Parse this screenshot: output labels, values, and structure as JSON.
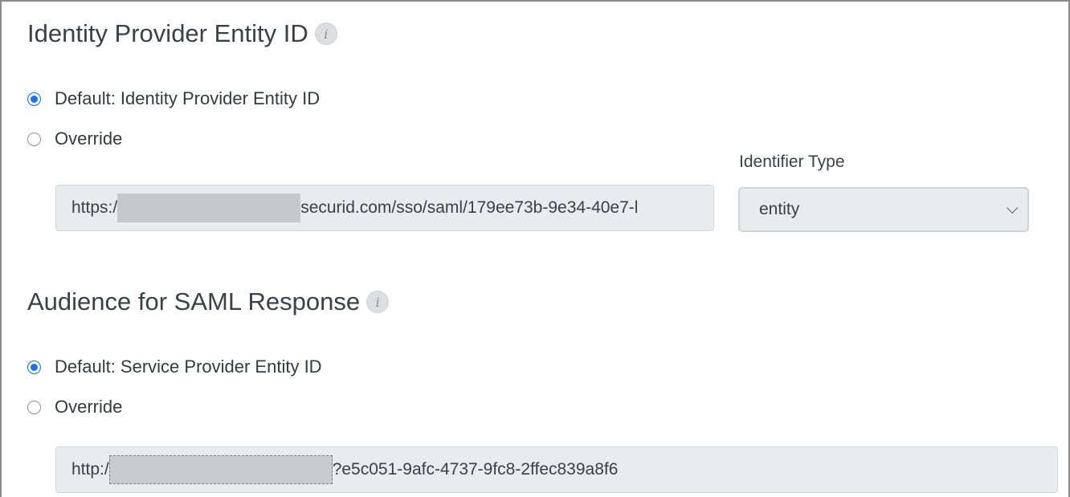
{
  "idp_section": {
    "title": "Identity Provider Entity ID",
    "info_icon": "info-icon",
    "radio_default_label": "Default: Identity Provider Entity ID",
    "radio_default_checked": true,
    "radio_override_label": "Override",
    "radio_override_checked": false,
    "entity_url_prefix": "https:/",
    "entity_url_suffix": "securid.com/sso/saml/179ee73b-9e34-40e7-l",
    "identifier_type_label": "Identifier Type",
    "identifier_type_value": "entity"
  },
  "audience_section": {
    "title": "Audience for SAML Response",
    "info_icon": "info-icon",
    "radio_default_label": "Default: Service Provider Entity ID",
    "radio_default_checked": true,
    "radio_override_label": "Override",
    "radio_override_checked": false,
    "audience_url_prefix": "http:/",
    "audience_url_suffix": "?e5c051-9afc-4737-9fc8-2ffec839a8f6"
  },
  "colors": {
    "accent": "#1a73e8",
    "field_bg": "#e9ecef",
    "redaction": "#c6c8ca"
  }
}
